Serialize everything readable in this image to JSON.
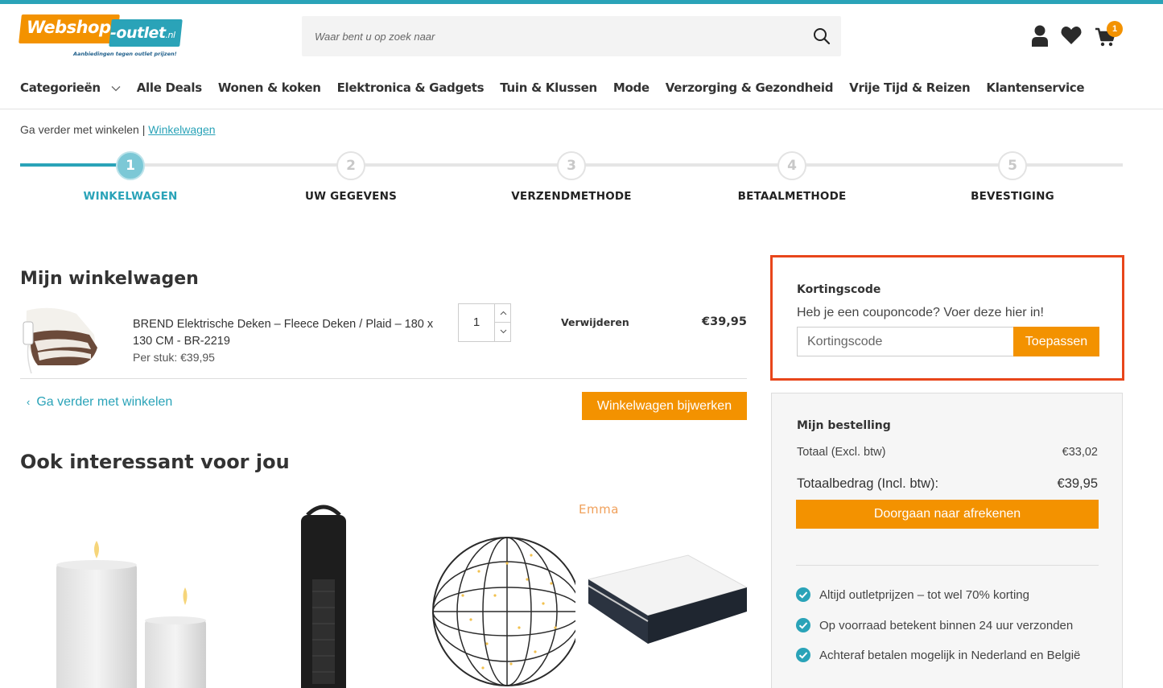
{
  "header": {
    "logo": {
      "left": "Webshop",
      "right": "-outlet",
      "tld": ".nl",
      "tagline": "Aanbiedingen tegen outlet prijzen!"
    },
    "search": {
      "placeholder": "Waar bent u op zoek naar",
      "icon": "search-icon"
    },
    "icons": {
      "account": "user-icon",
      "wishlist": "heart-icon",
      "cart": "cart-icon"
    },
    "cart_count": "1"
  },
  "nav": {
    "items": [
      {
        "label": "Categorieën"
      },
      {
        "label": "Alle Deals"
      },
      {
        "label": "Wonen & koken"
      },
      {
        "label": "Elektronica & Gadgets"
      },
      {
        "label": "Tuin & Klussen"
      },
      {
        "label": "Mode"
      },
      {
        "label": "Verzorging & Gezondheid"
      },
      {
        "label": "Vrije Tijd & Reizen"
      },
      {
        "label": "Klantenservice"
      }
    ]
  },
  "breadcrumb": {
    "text": "Ga verder met winkelen",
    "sep": " | ",
    "link": "Winkelwagen"
  },
  "steps": [
    {
      "num": "1",
      "label": "WINKELWAGEN",
      "active": true
    },
    {
      "num": "2",
      "label": "UW GEGEVENS",
      "active": false
    },
    {
      "num": "3",
      "label": "VERZENDMETHODE",
      "active": false
    },
    {
      "num": "4",
      "label": "BETAALMETHODE",
      "active": false
    },
    {
      "num": "5",
      "label": "BEVESTIGING",
      "active": false
    }
  ],
  "cart": {
    "title": "Mijn winkelwagen",
    "item": {
      "name": "BREND  Elektrische Deken – Fleece Deken / Plaid – 180 x 130 CM - BR-2219",
      "unit_price": "Per stuk: €39,95",
      "quantity": "1",
      "remove_label": "Verwijderen",
      "line_total": "€39,95"
    },
    "continue_label": "Ga verder met winkelen",
    "update_label": "Winkelwagen bijwerken"
  },
  "interesting": {
    "title": "Ook interessant voor jou",
    "brand_text": "Emma"
  },
  "coupon": {
    "title": "Kortingscode",
    "subtitle": "Heb je een couponcode? Voer deze hier in!",
    "placeholder": "Kortingscode",
    "button": "Toepassen",
    "highlight_color": "#e8461b"
  },
  "summary": {
    "title": "Mijn bestelling",
    "excl_label": "Totaal (Excl. btw)",
    "excl_value": "€33,02",
    "incl_label": "Totaalbedrag (Incl. btw):",
    "incl_value": "€39,95",
    "checkout_label": "Doorgaan naar afrekenen",
    "usps": [
      "Altijd outletprijzen – tot wel 70% korting",
      "Op voorraad betekent binnen 24 uur verzonden",
      "Achteraf betalen mogelijk in Nederland en België"
    ]
  },
  "colors": {
    "brand_orange": "#f39200",
    "brand_teal": "#2aa3b8"
  }
}
